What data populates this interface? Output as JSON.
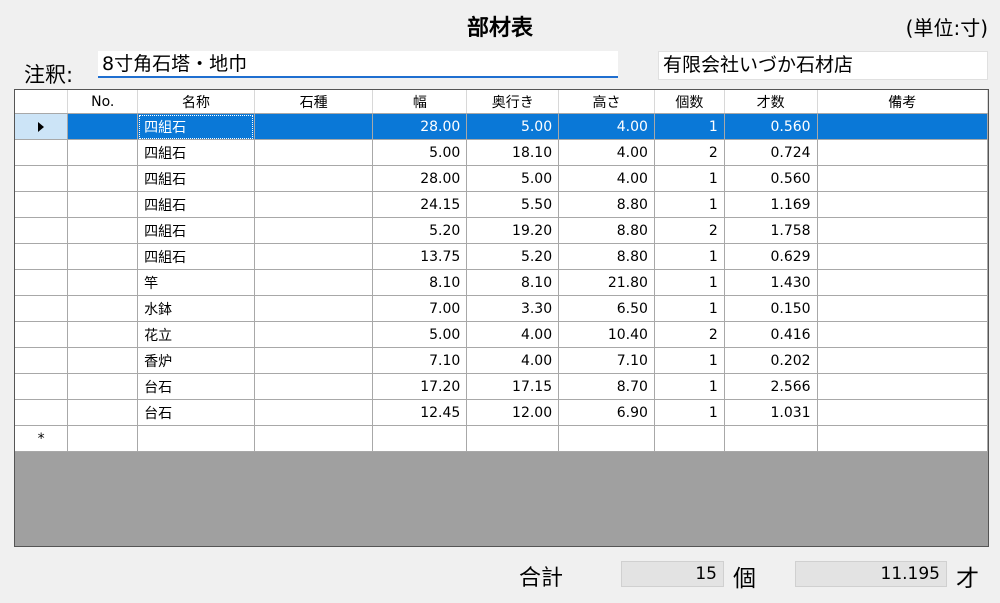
{
  "title": "部材表",
  "unit": "(単位:寸)",
  "note": {
    "label": "注釈:",
    "value": "8寸角石塔・地巾"
  },
  "company": "有限会社いづか石材店",
  "table": {
    "columns": [
      "",
      "No.",
      "名称",
      "石種",
      "幅",
      "奥行き",
      "高さ",
      "個数",
      "才数",
      "備考"
    ],
    "rows": [
      {
        "no": "",
        "name": "四組石",
        "stone": "",
        "width": "28.00",
        "depth": "5.00",
        "height": "4.00",
        "count": "1",
        "sai": "0.560",
        "remarks": ""
      },
      {
        "no": "",
        "name": "四組石",
        "stone": "",
        "width": "5.00",
        "depth": "18.10",
        "height": "4.00",
        "count": "2",
        "sai": "0.724",
        "remarks": ""
      },
      {
        "no": "",
        "name": "四組石",
        "stone": "",
        "width": "28.00",
        "depth": "5.00",
        "height": "4.00",
        "count": "1",
        "sai": "0.560",
        "remarks": ""
      },
      {
        "no": "",
        "name": "四組石",
        "stone": "",
        "width": "24.15",
        "depth": "5.50",
        "height": "8.80",
        "count": "1",
        "sai": "1.169",
        "remarks": ""
      },
      {
        "no": "",
        "name": "四組石",
        "stone": "",
        "width": "5.20",
        "depth": "19.20",
        "height": "8.80",
        "count": "2",
        "sai": "1.758",
        "remarks": ""
      },
      {
        "no": "",
        "name": "四組石",
        "stone": "",
        "width": "13.75",
        "depth": "5.20",
        "height": "8.80",
        "count": "1",
        "sai": "0.629",
        "remarks": ""
      },
      {
        "no": "",
        "name": "竿",
        "stone": "",
        "width": "8.10",
        "depth": "8.10",
        "height": "21.80",
        "count": "1",
        "sai": "1.430",
        "remarks": ""
      },
      {
        "no": "",
        "name": "水鉢",
        "stone": "",
        "width": "7.00",
        "depth": "3.30",
        "height": "6.50",
        "count": "1",
        "sai": "0.150",
        "remarks": ""
      },
      {
        "no": "",
        "name": "花立",
        "stone": "",
        "width": "5.00",
        "depth": "4.00",
        "height": "10.40",
        "count": "2",
        "sai": "0.416",
        "remarks": ""
      },
      {
        "no": "",
        "name": "香炉",
        "stone": "",
        "width": "7.10",
        "depth": "4.00",
        "height": "7.10",
        "count": "1",
        "sai": "0.202",
        "remarks": ""
      },
      {
        "no": "",
        "name": "台石",
        "stone": "",
        "width": "17.20",
        "depth": "17.15",
        "height": "8.70",
        "count": "1",
        "sai": "2.566",
        "remarks": ""
      },
      {
        "no": "",
        "name": "台石",
        "stone": "",
        "width": "12.45",
        "depth": "12.00",
        "height": "6.90",
        "count": "1",
        "sai": "1.031",
        "remarks": ""
      }
    ],
    "new_row_marker": "*"
  },
  "totals": {
    "label": "合計",
    "count": "15",
    "count_unit": "個",
    "sai": "11.195",
    "sai_unit": "才"
  },
  "colors": {
    "selection": "#0a78d7",
    "focus_underline": "#1f6fd0",
    "empty_area": "#a0a0a0"
  }
}
